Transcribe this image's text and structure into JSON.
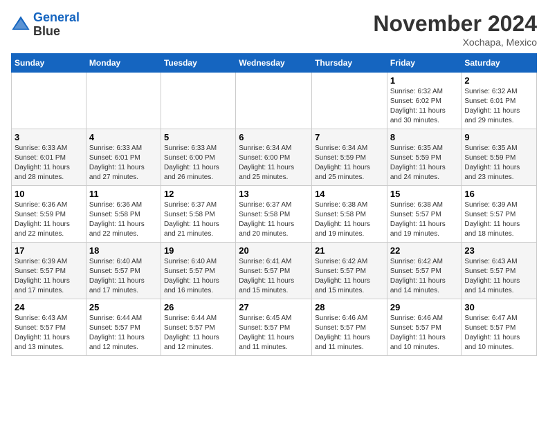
{
  "header": {
    "logo_line1": "General",
    "logo_line2": "Blue",
    "month": "November 2024",
    "location": "Xochapa, Mexico"
  },
  "days_of_week": [
    "Sunday",
    "Monday",
    "Tuesday",
    "Wednesday",
    "Thursday",
    "Friday",
    "Saturday"
  ],
  "weeks": [
    [
      {
        "day": "",
        "info": ""
      },
      {
        "day": "",
        "info": ""
      },
      {
        "day": "",
        "info": ""
      },
      {
        "day": "",
        "info": ""
      },
      {
        "day": "",
        "info": ""
      },
      {
        "day": "1",
        "info": "Sunrise: 6:32 AM\nSunset: 6:02 PM\nDaylight: 11 hours\nand 30 minutes."
      },
      {
        "day": "2",
        "info": "Sunrise: 6:32 AM\nSunset: 6:01 PM\nDaylight: 11 hours\nand 29 minutes."
      }
    ],
    [
      {
        "day": "3",
        "info": "Sunrise: 6:33 AM\nSunset: 6:01 PM\nDaylight: 11 hours\nand 28 minutes."
      },
      {
        "day": "4",
        "info": "Sunrise: 6:33 AM\nSunset: 6:01 PM\nDaylight: 11 hours\nand 27 minutes."
      },
      {
        "day": "5",
        "info": "Sunrise: 6:33 AM\nSunset: 6:00 PM\nDaylight: 11 hours\nand 26 minutes."
      },
      {
        "day": "6",
        "info": "Sunrise: 6:34 AM\nSunset: 6:00 PM\nDaylight: 11 hours\nand 25 minutes."
      },
      {
        "day": "7",
        "info": "Sunrise: 6:34 AM\nSunset: 5:59 PM\nDaylight: 11 hours\nand 25 minutes."
      },
      {
        "day": "8",
        "info": "Sunrise: 6:35 AM\nSunset: 5:59 PM\nDaylight: 11 hours\nand 24 minutes."
      },
      {
        "day": "9",
        "info": "Sunrise: 6:35 AM\nSunset: 5:59 PM\nDaylight: 11 hours\nand 23 minutes."
      }
    ],
    [
      {
        "day": "10",
        "info": "Sunrise: 6:36 AM\nSunset: 5:59 PM\nDaylight: 11 hours\nand 22 minutes."
      },
      {
        "day": "11",
        "info": "Sunrise: 6:36 AM\nSunset: 5:58 PM\nDaylight: 11 hours\nand 22 minutes."
      },
      {
        "day": "12",
        "info": "Sunrise: 6:37 AM\nSunset: 5:58 PM\nDaylight: 11 hours\nand 21 minutes."
      },
      {
        "day": "13",
        "info": "Sunrise: 6:37 AM\nSunset: 5:58 PM\nDaylight: 11 hours\nand 20 minutes."
      },
      {
        "day": "14",
        "info": "Sunrise: 6:38 AM\nSunset: 5:58 PM\nDaylight: 11 hours\nand 19 minutes."
      },
      {
        "day": "15",
        "info": "Sunrise: 6:38 AM\nSunset: 5:57 PM\nDaylight: 11 hours\nand 19 minutes."
      },
      {
        "day": "16",
        "info": "Sunrise: 6:39 AM\nSunset: 5:57 PM\nDaylight: 11 hours\nand 18 minutes."
      }
    ],
    [
      {
        "day": "17",
        "info": "Sunrise: 6:39 AM\nSunset: 5:57 PM\nDaylight: 11 hours\nand 17 minutes."
      },
      {
        "day": "18",
        "info": "Sunrise: 6:40 AM\nSunset: 5:57 PM\nDaylight: 11 hours\nand 17 minutes."
      },
      {
        "day": "19",
        "info": "Sunrise: 6:40 AM\nSunset: 5:57 PM\nDaylight: 11 hours\nand 16 minutes."
      },
      {
        "day": "20",
        "info": "Sunrise: 6:41 AM\nSunset: 5:57 PM\nDaylight: 11 hours\nand 15 minutes."
      },
      {
        "day": "21",
        "info": "Sunrise: 6:42 AM\nSunset: 5:57 PM\nDaylight: 11 hours\nand 15 minutes."
      },
      {
        "day": "22",
        "info": "Sunrise: 6:42 AM\nSunset: 5:57 PM\nDaylight: 11 hours\nand 14 minutes."
      },
      {
        "day": "23",
        "info": "Sunrise: 6:43 AM\nSunset: 5:57 PM\nDaylight: 11 hours\nand 14 minutes."
      }
    ],
    [
      {
        "day": "24",
        "info": "Sunrise: 6:43 AM\nSunset: 5:57 PM\nDaylight: 11 hours\nand 13 minutes."
      },
      {
        "day": "25",
        "info": "Sunrise: 6:44 AM\nSunset: 5:57 PM\nDaylight: 11 hours\nand 12 minutes."
      },
      {
        "day": "26",
        "info": "Sunrise: 6:44 AM\nSunset: 5:57 PM\nDaylight: 11 hours\nand 12 minutes."
      },
      {
        "day": "27",
        "info": "Sunrise: 6:45 AM\nSunset: 5:57 PM\nDaylight: 11 hours\nand 11 minutes."
      },
      {
        "day": "28",
        "info": "Sunrise: 6:46 AM\nSunset: 5:57 PM\nDaylight: 11 hours\nand 11 minutes."
      },
      {
        "day": "29",
        "info": "Sunrise: 6:46 AM\nSunset: 5:57 PM\nDaylight: 11 hours\nand 10 minutes."
      },
      {
        "day": "30",
        "info": "Sunrise: 6:47 AM\nSunset: 5:57 PM\nDaylight: 11 hours\nand 10 minutes."
      }
    ]
  ]
}
